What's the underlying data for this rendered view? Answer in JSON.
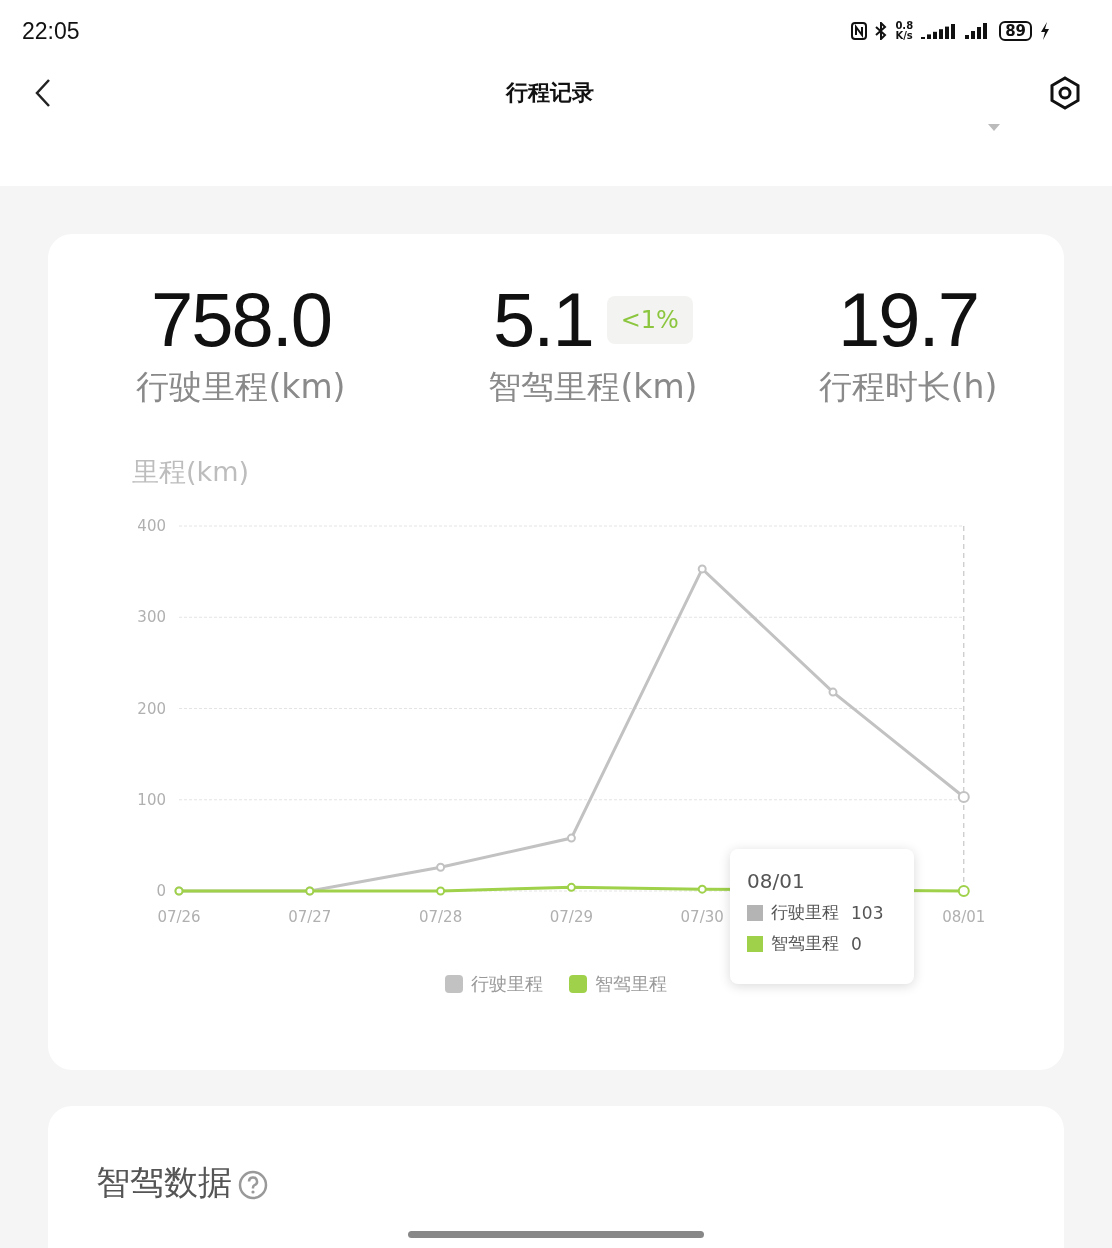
{
  "status_bar": {
    "time": "22:05",
    "net_speed_value": "0.8",
    "net_speed_unit": "K/s",
    "battery": "89"
  },
  "header": {
    "title": "行程记录"
  },
  "summary": [
    {
      "value": "758.0",
      "label": "行驶里程(km)"
    },
    {
      "value": "5.1",
      "badge": "<1%",
      "label": "智驾里程(km)"
    },
    {
      "value": "19.7",
      "label": "行程时长(h)"
    }
  ],
  "chart": {
    "label": "里程(km)",
    "chart_data": {
      "type": "line",
      "x": [
        "07/26",
        "07/27",
        "07/28",
        "07/29",
        "07/30",
        null,
        "08/01"
      ],
      "ylim": [
        0,
        400
      ],
      "yticks": [
        0,
        100,
        200,
        300,
        400
      ],
      "grid": true,
      "legend": "bottom",
      "series": [
        {
          "name": "行驶里程",
          "color": "#c2c2c2",
          "marker": "circle",
          "values": [
            0,
            0,
            26,
            58,
            353,
            218,
            103
          ]
        },
        {
          "name": "智驾里程",
          "color": "#9fd14a",
          "marker": "circle",
          "values": [
            0,
            0,
            0,
            4,
            2,
            null,
            0
          ]
        }
      ]
    },
    "tooltip": {
      "title": "08/01",
      "rows": [
        {
          "name": "行驶里程",
          "value": "103",
          "color": "#b4b4b4"
        },
        {
          "name": "智驾里程",
          "value": "0",
          "color": "#9fd14a"
        }
      ]
    }
  },
  "section": {
    "title": "智驾数据"
  }
}
